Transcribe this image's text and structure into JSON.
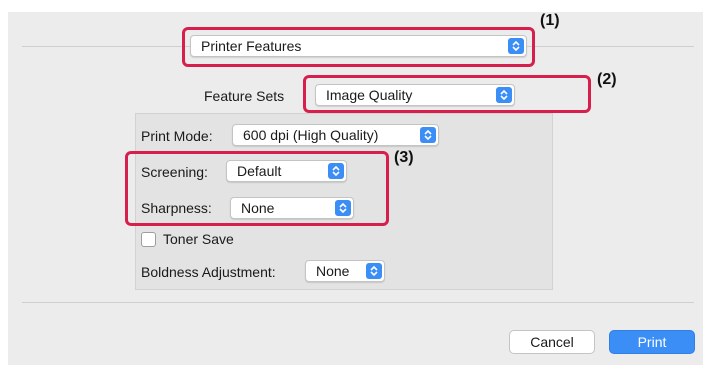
{
  "header": {
    "panel_select": {
      "value": "Printer Features"
    }
  },
  "feature_sets": {
    "label": "Feature Sets",
    "value": "Image Quality"
  },
  "options": {
    "print_mode": {
      "label": "Print Mode:",
      "value": "600 dpi (High Quality)"
    },
    "screening": {
      "label": "Screening:",
      "value": "Default"
    },
    "sharpness": {
      "label": "Sharpness:",
      "value": "None"
    },
    "toner_save": {
      "label": "Toner Save",
      "checked": false
    },
    "boldness": {
      "label": "Boldness Adjustment:",
      "value": "None"
    }
  },
  "callouts": [
    "(1)",
    "(2)",
    "(3)"
  ],
  "buttons": {
    "cancel": "Cancel",
    "print": "Print"
  },
  "colors": {
    "accent": "#3b8ef6",
    "highlight": "#d71f4e",
    "panel_bg": "#ececec"
  },
  "icons": {
    "popup_stepper": "chevron-up-down-icon"
  }
}
